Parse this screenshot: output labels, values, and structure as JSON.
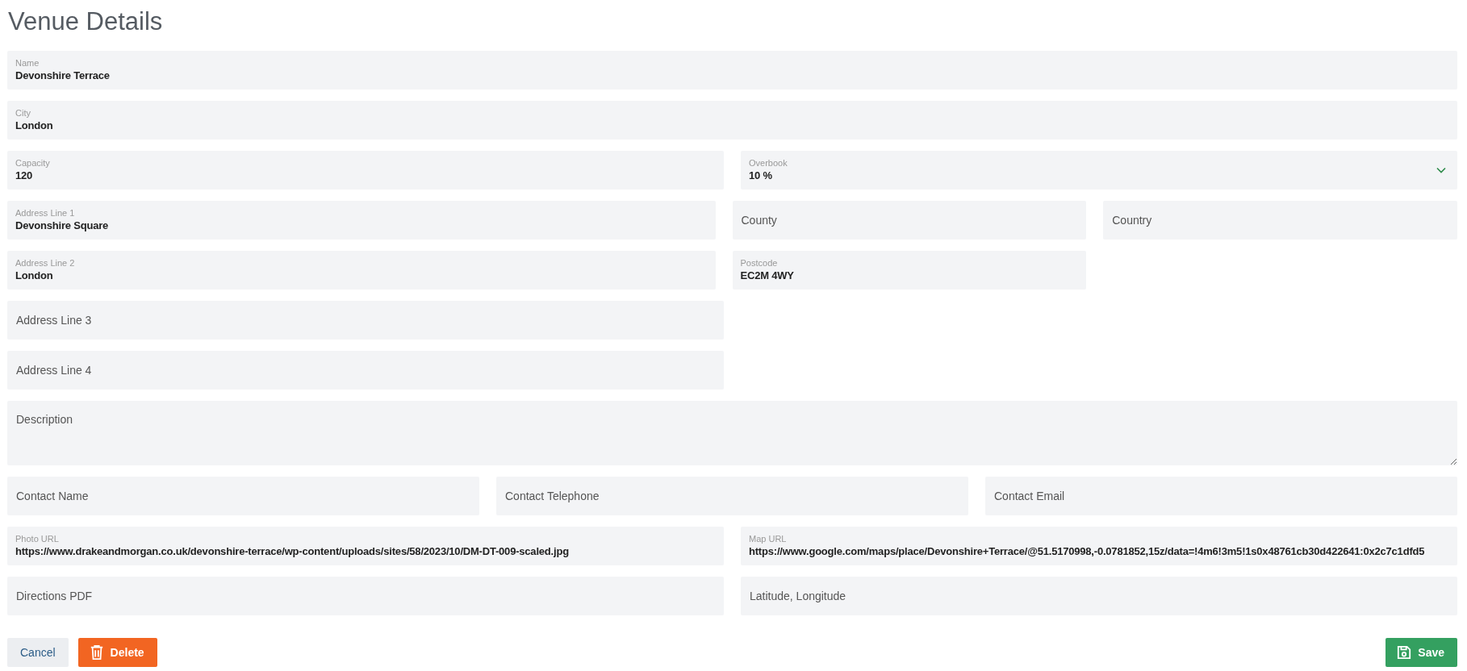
{
  "title": "Venue Details",
  "rows": [
    {
      "kind": "full",
      "fields": [
        {
          "kind": "text",
          "label": "Name",
          "value": "Devonshire Terrace"
        }
      ]
    },
    {
      "kind": "full",
      "fields": [
        {
          "kind": "text",
          "label": "City",
          "value": "London"
        }
      ]
    },
    {
      "kind": "halves",
      "fields": [
        {
          "kind": "text",
          "label": "Capacity",
          "value": "120"
        },
        {
          "kind": "select",
          "label": "Overbook",
          "value": "10 %"
        }
      ]
    },
    {
      "kind": "half_quarters",
      "fields": [
        {
          "kind": "text",
          "label": "Address Line 1",
          "value": "Devonshire Square"
        },
        {
          "kind": "text",
          "placeholder": "County"
        },
        {
          "kind": "text",
          "placeholder": "Country"
        }
      ]
    },
    {
      "kind": "half_quarters",
      "fields": [
        {
          "kind": "text",
          "label": "Address Line 2",
          "value": "London"
        },
        {
          "kind": "text",
          "label": "Postcode",
          "value": "EC2M 4WY"
        }
      ]
    },
    {
      "kind": "halves",
      "fields": [
        {
          "kind": "text",
          "placeholder": "Address Line 3"
        }
      ]
    },
    {
      "kind": "halves",
      "fields": [
        {
          "kind": "text",
          "placeholder": "Address Line 4"
        }
      ]
    },
    {
      "kind": "full",
      "fields": [
        {
          "kind": "textarea",
          "placeholder": "Description"
        }
      ]
    },
    {
      "kind": "thirds",
      "fields": [
        {
          "kind": "text",
          "placeholder": "Contact Name"
        },
        {
          "kind": "text",
          "placeholder": "Contact Telephone"
        },
        {
          "kind": "text",
          "placeholder": "Contact Email"
        }
      ]
    },
    {
      "kind": "halves",
      "fields": [
        {
          "kind": "text",
          "label": "Photo URL",
          "value": "https://www.drakeandmorgan.co.uk/devonshire-terrace/wp-content/uploads/sites/58/2023/10/DM-DT-009-scaled.jpg"
        },
        {
          "kind": "text",
          "label": "Map URL",
          "value": "https://www.google.com/maps/place/Devonshire+Terrace/@51.5170998,-0.0781852,15z/data=!4m6!3m5!1s0x48761cb30d422641:0x2c7c1dfd5"
        }
      ]
    },
    {
      "kind": "halves",
      "fields": [
        {
          "kind": "text",
          "placeholder": "Directions PDF"
        },
        {
          "kind": "text",
          "placeholder": "Latitude, Longitude"
        }
      ]
    }
  ],
  "buttons": [
    {
      "kind": "cancel",
      "label": "Cancel"
    },
    {
      "kind": "delete",
      "label": "Delete"
    },
    {
      "kind": "save",
      "label": "Save"
    }
  ]
}
